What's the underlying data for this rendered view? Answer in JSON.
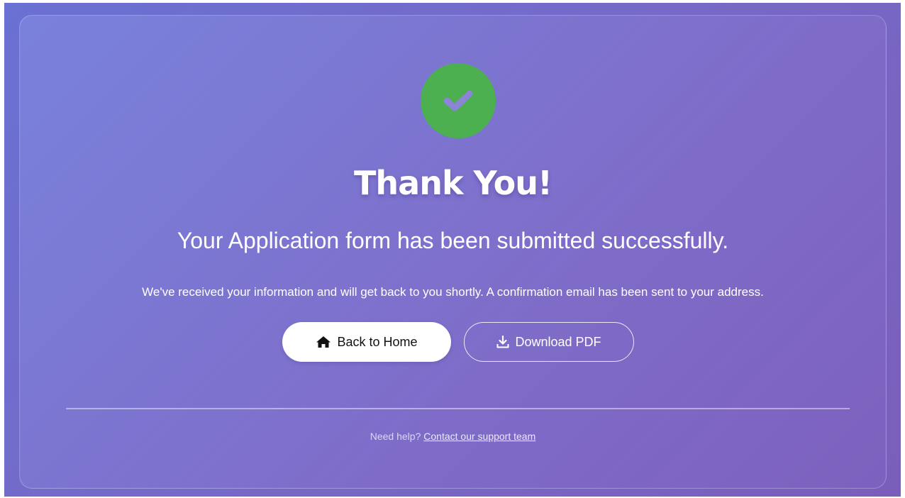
{
  "success_icon": {
    "name": "check-circle-icon",
    "color": "#4caf50"
  },
  "heading": {
    "title": "Thank You!",
    "subtitle": "Your Application form has been submitted successfully.",
    "message": "We've received your information and will get back to you shortly. A confirmation email has been sent to your address."
  },
  "actions": {
    "home_icon": "home-icon",
    "home_label": "Back to Home",
    "download_icon": "download-icon",
    "download_label": "Download PDF"
  },
  "footer": {
    "help_prefix": "Need help?",
    "help_link": "Contact our support team"
  },
  "colors": {
    "background_start": "#6a71d2",
    "background_end": "#7a5ebb",
    "success": "#4caf50",
    "button_fill": "#ffffff"
  }
}
